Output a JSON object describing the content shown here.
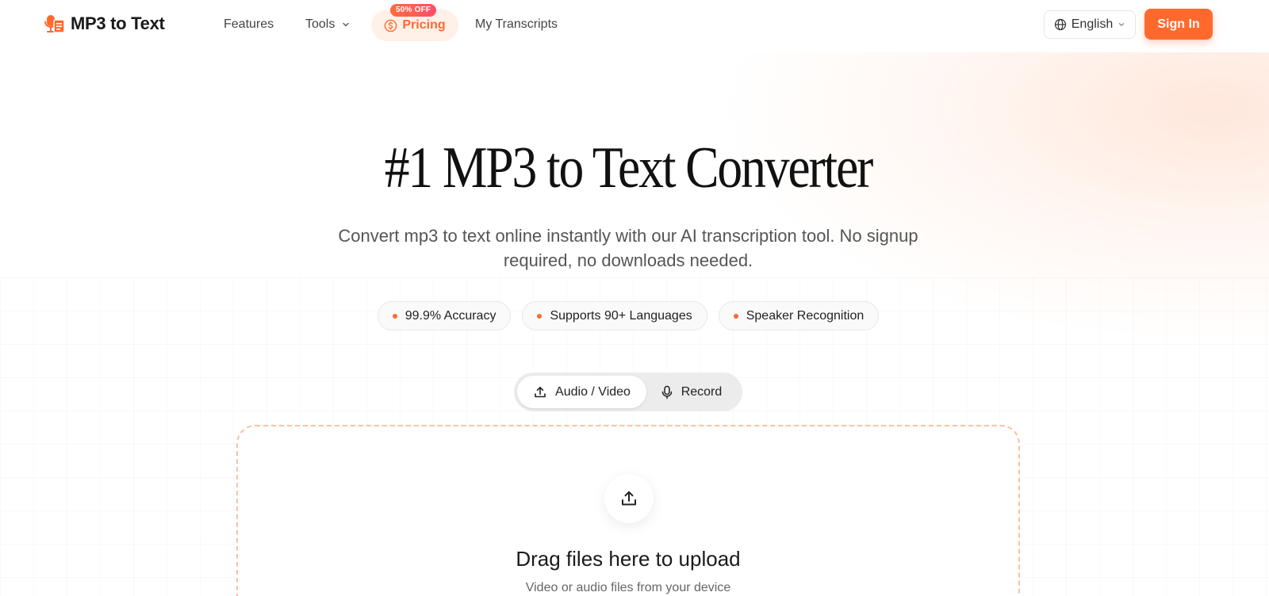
{
  "nav": {
    "logo_text": "MP3 to Text",
    "features": "Features",
    "tools": "Tools",
    "pricing": "Pricing",
    "pricing_badge": "50% OFF",
    "my_transcripts": "My Transcripts",
    "language": "English",
    "sign_in": "Sign In"
  },
  "hero": {
    "title": "#1 MP3 to Text Converter",
    "subtitle": "Convert mp3 to text online instantly with our AI transcription tool. No signup required, no downloads needed.",
    "chips": [
      "99.9% Accuracy",
      "Supports 90+ Languages",
      "Speaker Recognition"
    ]
  },
  "mode_tabs": {
    "audio_video": "Audio / Video",
    "record": "Record",
    "active": "audio_video"
  },
  "upload": {
    "title": "Drag files here to upload",
    "subtitle": "Video or audio files from your device"
  },
  "colors": {
    "accent": "#ff6a2c",
    "pricing_bg": "#fff1e8",
    "dropzone_border": "#ffc0a3"
  },
  "icons": {
    "logo": "mic-document-icon",
    "tools_dropdown": "chevron-down-icon",
    "pricing": "dollar-circle-icon",
    "language": "globe-icon",
    "audio_video_tab": "upload-icon",
    "record_tab": "microphone-icon",
    "dropzone": "upload-icon"
  }
}
